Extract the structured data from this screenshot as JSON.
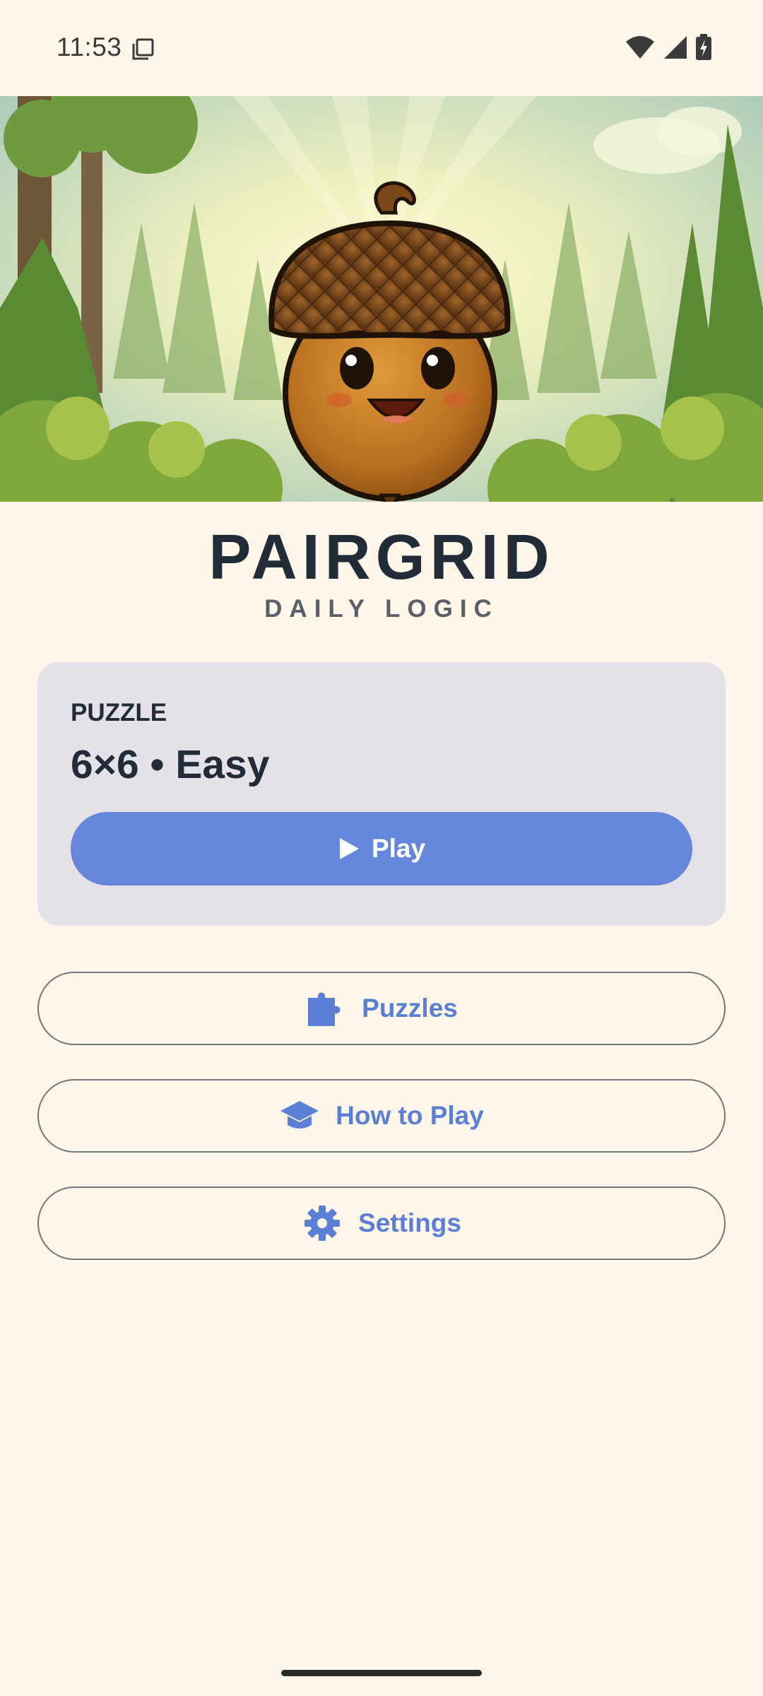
{
  "status_bar": {
    "time": "11:53",
    "icons": [
      "screenshot-copy-icon",
      "wifi-icon",
      "cellular-signal-icon",
      "battery-charging-icon"
    ]
  },
  "hero": {
    "image": "acorn-mascot-forest-banner"
  },
  "app": {
    "title": "PAIRGRID",
    "subtitle": "DAILY LOGIC"
  },
  "puzzle_card": {
    "label": "PUZZLE",
    "value": "6×6 • Easy",
    "play_label": "Play",
    "play_icon": "play-icon"
  },
  "menu": {
    "puzzles_label": "Puzzles",
    "puzzles_icon": "puzzle-piece-icon",
    "how_to_play_label": "How to Play",
    "how_to_play_icon": "graduation-cap-icon",
    "settings_label": "Settings",
    "settings_icon": "gear-icon"
  },
  "colors": {
    "background": "#fdf6e9",
    "title": "#222b38",
    "accent": "#6687d9",
    "card": "#e5e1e8",
    "button_text": "#5c7fd6"
  }
}
